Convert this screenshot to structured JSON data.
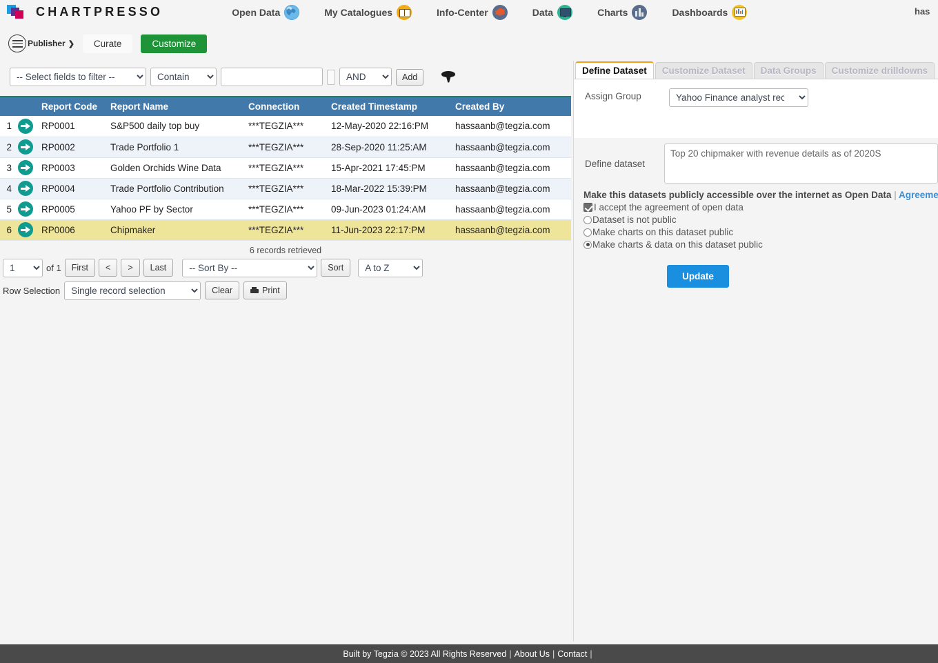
{
  "app": {
    "brand": "CHARTPRESSO",
    "logo_icon": "chartpresso-logo-icon",
    "user": "has"
  },
  "topnav": {
    "items": [
      {
        "label": "Open Data",
        "icon": "globe-icon"
      },
      {
        "label": "My Catalogues",
        "icon": "book-icon"
      },
      {
        "label": "Info-Center",
        "icon": "layers-icon"
      },
      {
        "label": "Data",
        "icon": "monitor-icon"
      },
      {
        "label": "Charts",
        "icon": "bar-chart-icon"
      },
      {
        "label": "Dashboards",
        "icon": "dashboard-icon"
      }
    ]
  },
  "subnav": {
    "menu_icon": "hamburger-menu-icon",
    "publisher_label": "Publisher",
    "publisher_caret": "❯",
    "tabs": [
      {
        "label": "Curate",
        "active": false
      },
      {
        "label": "Customize",
        "active": true
      }
    ]
  },
  "filterbar": {
    "fields_select": "-- Select fields to filter --",
    "operator_select": "Contain",
    "value_input": "",
    "value_placeholder": "",
    "logic_select": "AND",
    "add_label": "Add",
    "funnel_icon": "funnel-filter-icon"
  },
  "table": {
    "columns": [
      "",
      "",
      "Report Code",
      "Report Name",
      "Connection",
      "Created Timestamp",
      "Created By"
    ],
    "row_arrow_icon": "open-record-arrow-icon",
    "rows": [
      {
        "idx": "1",
        "code": "RP0001",
        "name": "S&P500 daily top buy",
        "connection": "***TEGZIA***",
        "created": "12-May-2020 22:16:PM",
        "by": "hassaanb@tegzia.com",
        "selected": false
      },
      {
        "idx": "2",
        "code": "RP0002",
        "name": "Trade Portfolio 1",
        "connection": "***TEGZIA***",
        "created": "28-Sep-2020 11:25:AM",
        "by": "hassaanb@tegzia.com",
        "selected": false
      },
      {
        "idx": "3",
        "code": "RP0003",
        "name": "Golden Orchids Wine Data",
        "connection": "***TEGZIA***",
        "created": "15-Apr-2021 17:45:PM",
        "by": "hassaanb@tegzia.com",
        "selected": false
      },
      {
        "idx": "4",
        "code": "RP0004",
        "name": "Trade Portfolio Contribution",
        "connection": "***TEGZIA***",
        "created": "18-Mar-2022 15:39:PM",
        "by": "hassaanb@tegzia.com",
        "selected": false
      },
      {
        "idx": "5",
        "code": "RP0005",
        "name": "Yahoo PF by Sector",
        "connection": "***TEGZIA***",
        "created": "09-Jun-2023 01:24:AM",
        "by": "hassaanb@tegzia.com",
        "selected": false
      },
      {
        "idx": "6",
        "code": "RP0006",
        "name": "Chipmaker",
        "connection": "***TEGZIA***",
        "created": "11-Jun-2023 22:17:PM",
        "by": "hassaanb@tegzia.com",
        "selected": true
      }
    ]
  },
  "pagination": {
    "records_text": "6 records retrieved",
    "page_value": "1",
    "of_text": "of 1",
    "first_label": "First",
    "prev_label": "<",
    "next_label": ">",
    "last_label": "Last",
    "sort_by_value": "-- Sort By --",
    "sort_label": "Sort",
    "order_value": "A to Z",
    "row_selection_label": "Row Selection",
    "row_selection_value": "Single record selection",
    "clear_label": "Clear",
    "print_label": "Print",
    "print_icon": "printer-icon"
  },
  "right_panel": {
    "tabs": [
      {
        "label": "Define Dataset",
        "active": true
      },
      {
        "label": "Customize Dataset",
        "active": false
      },
      {
        "label": "Data Groups",
        "active": false
      },
      {
        "label": "Customize drilldowns",
        "active": false
      }
    ],
    "assign_group_label": "Assign Group",
    "assign_group_value": "Yahoo Finance analyst recor",
    "define_dataset_label": "Define dataset",
    "define_dataset_value": "Top 20 chipmaker with revenue details as of 2020S",
    "open_data_text": "Make this datasets publicly accessible over the internet as Open Data",
    "open_data_sep": "|",
    "agreement_link": "Agreement o",
    "checkbox_label": "I accept the agreement of open data",
    "checkbox_checked": true,
    "radios": [
      {
        "label": "Dataset is not public",
        "selected": false
      },
      {
        "label": "Make charts on this dataset public",
        "selected": false
      },
      {
        "label": "Make charts & data on this dataset public",
        "selected": true
      }
    ],
    "update_label": "Update"
  },
  "footer": {
    "built_by": "Built by Tegzia",
    "copyright": "© 2023 All Rights Reserved",
    "about": "About Us",
    "contact": "Contact",
    "sep": "|"
  },
  "colors": {
    "accent_green": "#1f9337",
    "table_header_blue": "#4279ab",
    "selected_row_yellow": "#eee49a",
    "arrow_teal": "#0f9b90",
    "update_blue": "#1a8fe0",
    "active_tab_orange": "#f0a01e",
    "footer_gray": "#4a4a4a"
  }
}
